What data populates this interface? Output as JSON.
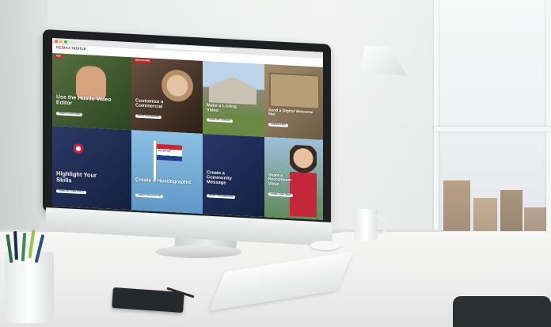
{
  "site": {
    "logo_brand": "RE/MAX",
    "logo_rest": " HUSTLE",
    "brand_red": "#d6202a",
    "brand_blue": "#1f3d8a"
  },
  "tiles": [
    {
      "title": "Use the Hustle Video Editor",
      "button": "CREATE YOUR VIDEO",
      "badge": "NEW",
      "bg": "#3f5a2e"
    },
    {
      "title": "Customize a Commercial",
      "button": "START CUSTOMIZING",
      "badge": "NEW FEATURE",
      "bg": "#4a3a2c"
    },
    {
      "title": "Make a Listing Video",
      "button": "SHOW OFF LISTINGS",
      "badge": "",
      "bg": "#6c7f4c"
    },
    {
      "title": "Send a Digital Welcome Mat",
      "button": "CREATE A MAT",
      "badge": "",
      "bg": "#8a7a62"
    },
    {
      "title": "Highlight Your Skills",
      "button": "SHOW OFF YOUR TOOLS",
      "badge": "",
      "bg": "#1e2b52"
    },
    {
      "title": "Create a Hustlegraphic",
      "button": "CREATE INFOGRAPHIC",
      "badge": "",
      "bg": "#7bb1d8"
    },
    {
      "title": "Create a Community Message",
      "button": "START YOUR MESSAGE",
      "badge": "",
      "bg": "#1c2a50"
    },
    {
      "title": "Share a Recruitment Video",
      "button": "GROW YOUR TEAM",
      "badge": "",
      "bg": "#6c8fae"
    }
  ],
  "sign_text": "SOLD/FOR"
}
